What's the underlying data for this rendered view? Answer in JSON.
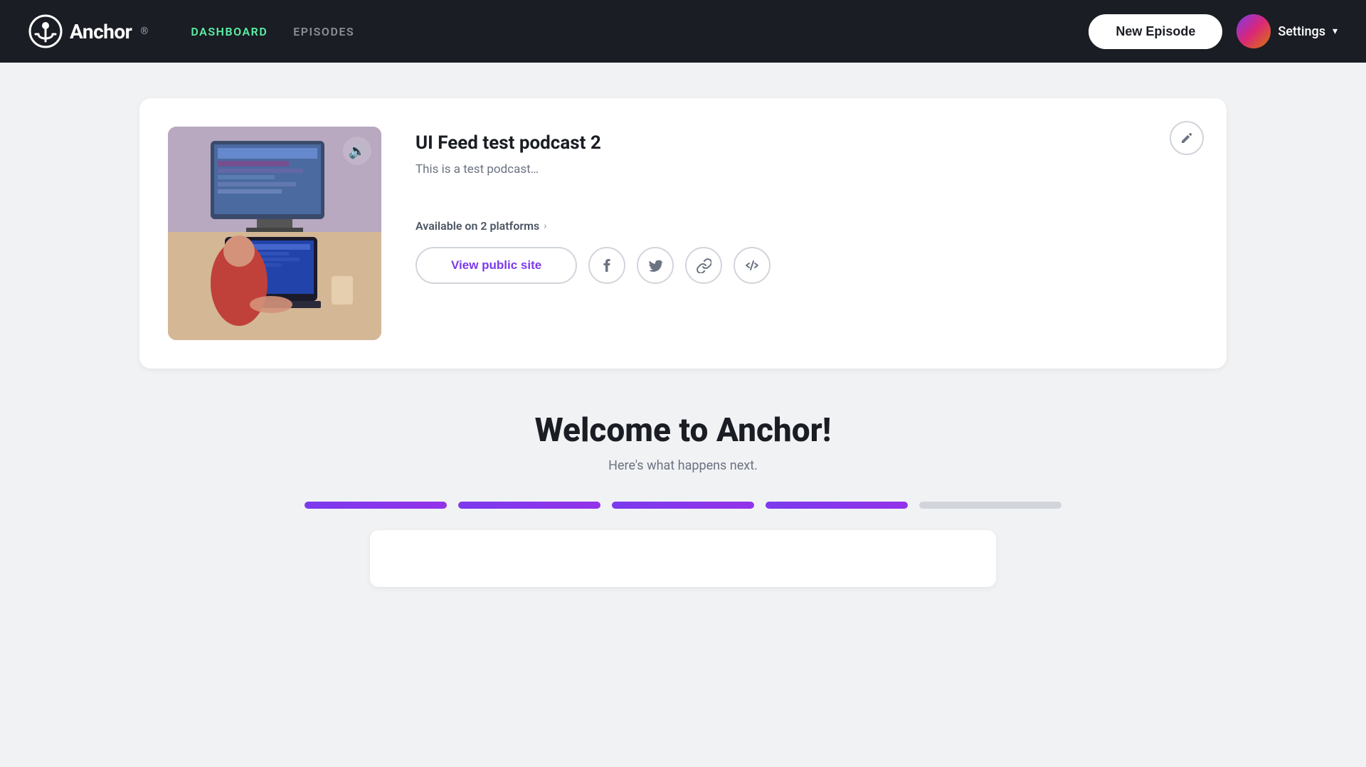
{
  "navbar": {
    "brand": "Anchor",
    "nav_items": [
      {
        "label": "DASHBOARD",
        "active": true
      },
      {
        "label": "EPISODES",
        "active": false
      }
    ],
    "new_episode_label": "New Episode",
    "settings_label": "Settings"
  },
  "podcast_card": {
    "title": "UI Feed test podcast 2",
    "description": "This is a test podcast…",
    "platforms_label": "Available on 2 platforms",
    "view_public_label": "View public site",
    "social_buttons": [
      {
        "name": "facebook",
        "icon": "f"
      },
      {
        "name": "twitter",
        "icon": "t"
      },
      {
        "name": "link",
        "icon": "🔗"
      },
      {
        "name": "embed",
        "icon": "</>"
      }
    ]
  },
  "welcome": {
    "title": "Welcome to Anchor!",
    "subtitle": "Here's what happens next.",
    "steps": [
      {
        "active": true
      },
      {
        "active": true
      },
      {
        "active": true
      },
      {
        "active": true
      },
      {
        "active": false
      }
    ]
  },
  "icons": {
    "audio": "📻",
    "edit": "✏",
    "chevron_right": "›",
    "chevron_down": "▾",
    "facebook": "f",
    "twitter": "t",
    "link": "⛓",
    "embed": "</>",
    "anchor_logo": "◎"
  }
}
